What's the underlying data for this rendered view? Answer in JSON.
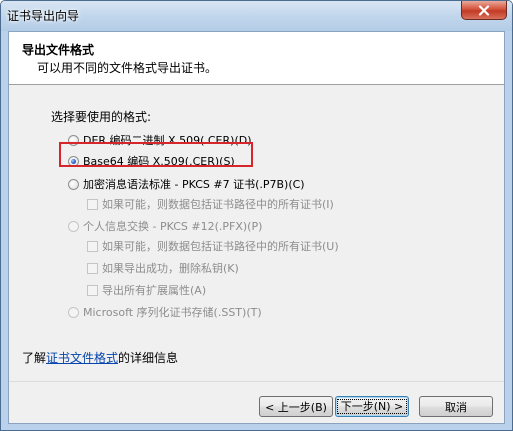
{
  "window": {
    "title": "证书导出向导"
  },
  "header": {
    "title": "导出文件格式",
    "subtitle": "可以用不同的文件格式导出证书。"
  },
  "format_prompt": "选择要使用的格式:",
  "options": {
    "der": "DER 编码二进制 X.509(.CER)(D)",
    "base64": "Base64 编码 X.509(.CER)(S)",
    "pkcs7": "加密消息语法标准 - PKCS #7 证书(.P7B)(C)",
    "pkcs7_include_all": "如果可能，则数据包括证书路径中的所有证书(I)",
    "pfx": "个人信息交换 - PKCS #12(.PFX)(P)",
    "pfx_include_all": "如果可能，则数据包括证书路径中的所有证书(U)",
    "pfx_delete_key": "如果导出成功，删除私钥(K)",
    "pfx_export_ext": "导出所有扩展属性(A)",
    "sst": "Microsoft 序列化证书存储(.SST)(T)"
  },
  "selected_option": "base64",
  "info": {
    "prefix": "了解",
    "link": "证书文件格式",
    "suffix": "的详细信息"
  },
  "buttons": {
    "back": "< 上一步(B)",
    "next": "下一步(N) >",
    "cancel": "取消"
  },
  "colors": {
    "highlight_box": "#d6262b",
    "link": "#0645ad",
    "title_bar": "#b9d1ea",
    "close_button": "#c23a25"
  }
}
